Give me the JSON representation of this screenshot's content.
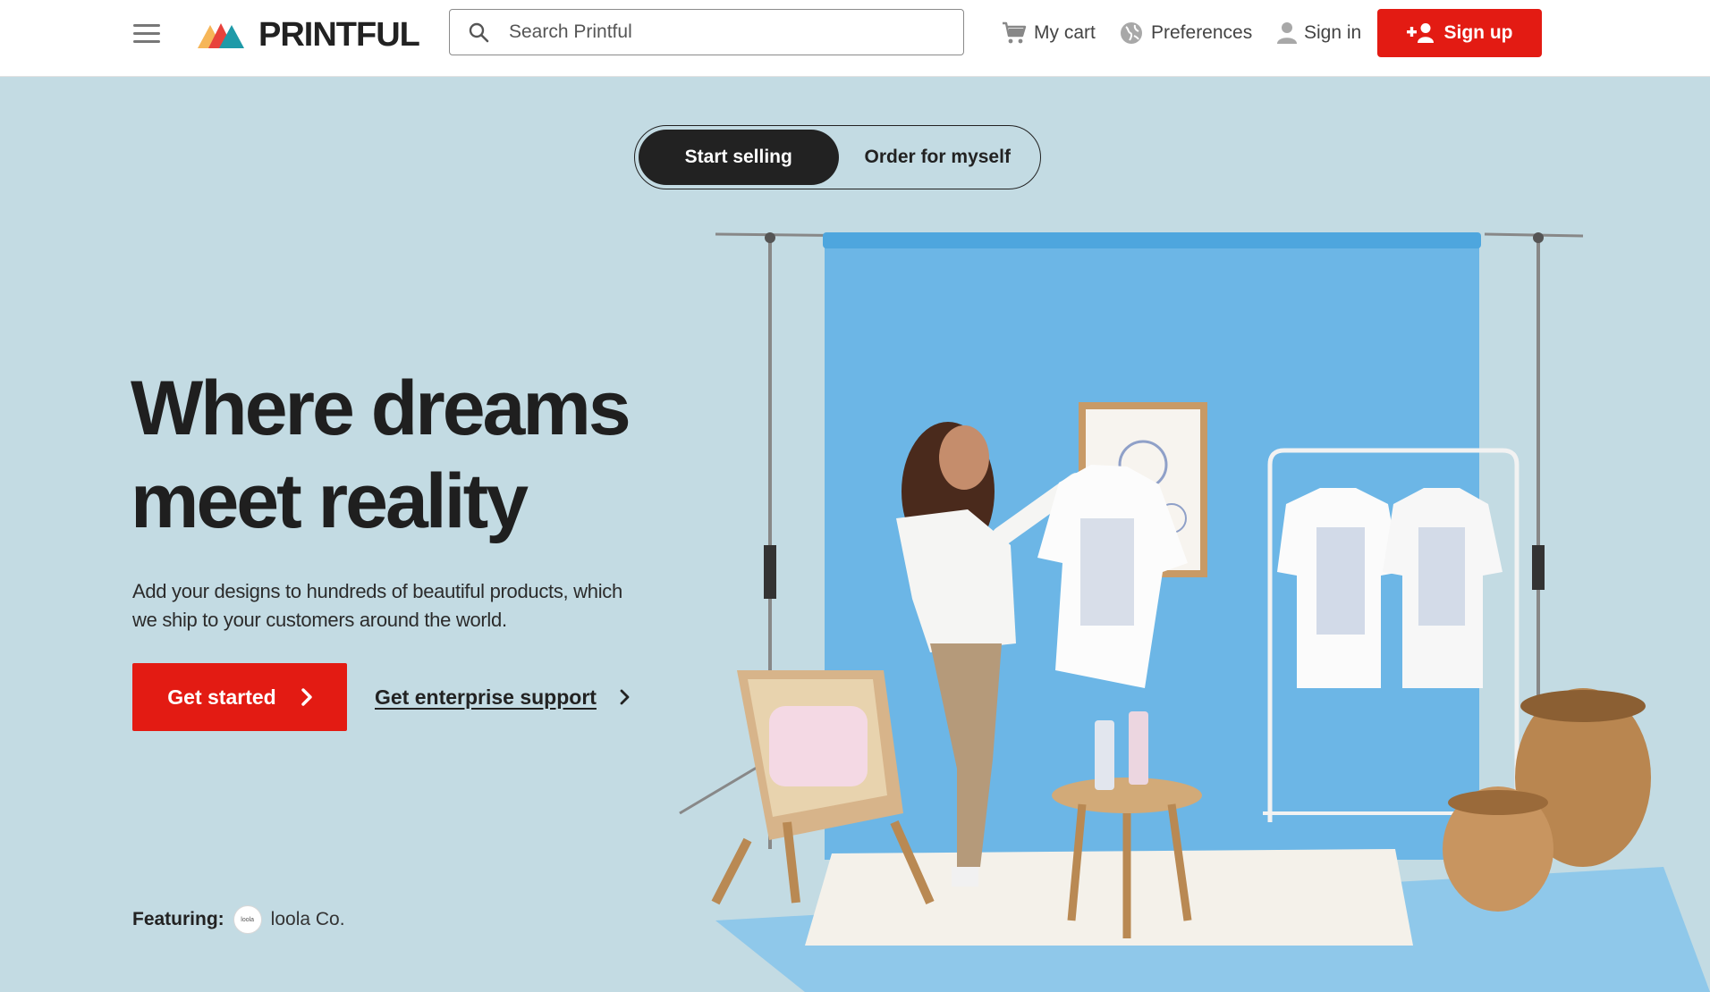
{
  "header": {
    "brand": "PRINTFUL",
    "search": {
      "placeholder": "Search Printful"
    },
    "nav": {
      "cart": "My cart",
      "preferences": "Preferences",
      "sign_in": "Sign in",
      "sign_up": "Sign up"
    }
  },
  "toggle": {
    "options": [
      {
        "label": "Start selling",
        "active": true
      },
      {
        "label": "Order for myself",
        "active": false
      }
    ]
  },
  "hero": {
    "title_line1": "Where dreams",
    "title_line2": "meet reality",
    "subtitle": "Add your designs to hundreds of beautiful products, which we ship to your customers around the world.",
    "cta_primary": "Get started",
    "cta_secondary": "Get enterprise support"
  },
  "featuring": {
    "label": "Featuring:",
    "brand": "loola Co.",
    "logo_text": "loola"
  },
  "colors": {
    "accent": "#e31b13",
    "hero_bg": "#c3dbe3",
    "backdrop": "#6cb6e6",
    "text_dark": "#1f1f1f"
  }
}
